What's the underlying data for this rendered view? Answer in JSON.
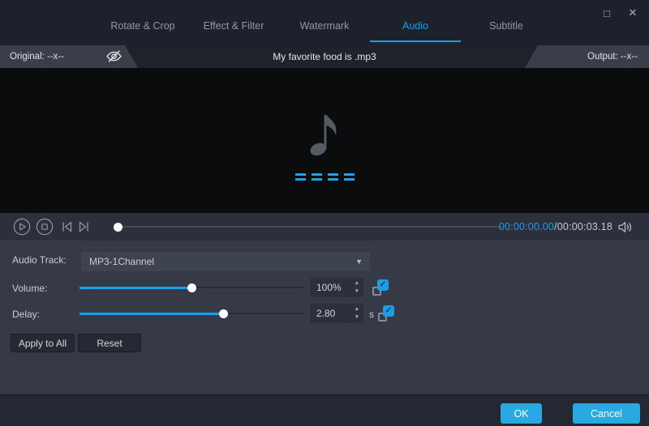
{
  "window": {
    "tabs": [
      "Rotate & Crop",
      "Effect & Filter",
      "Watermark",
      "Audio",
      "Subtitle"
    ],
    "active_tab": "Audio"
  },
  "info_bar": {
    "original": "Original: --x--",
    "file_title": "My favorite food is .mp3",
    "output": "Output: --x--"
  },
  "player": {
    "elapsed": "00:00:00.00",
    "duration": "/00:00:03.18",
    "progress_percent": 0
  },
  "audio": {
    "track_label": "Audio Track:",
    "track_value": "MP3-1Channel",
    "volume_label": "Volume:",
    "volume_value": "100%",
    "volume_percent": 50,
    "delay_label": "Delay:",
    "delay_value": "2.80",
    "delay_unit": "s",
    "delay_percent": 64
  },
  "buttons": {
    "apply_all": "Apply to All",
    "reset": "Reset",
    "ok": "OK",
    "cancel": "Cancel"
  },
  "icons": {
    "maximize": "□",
    "close": "✕",
    "dropdown": "▼",
    "spin_up": "▲",
    "spin_down": "▼",
    "check": "✓"
  },
  "colors": {
    "accent_blue": "#1e9de9",
    "button_blue": "#29a9e1"
  }
}
